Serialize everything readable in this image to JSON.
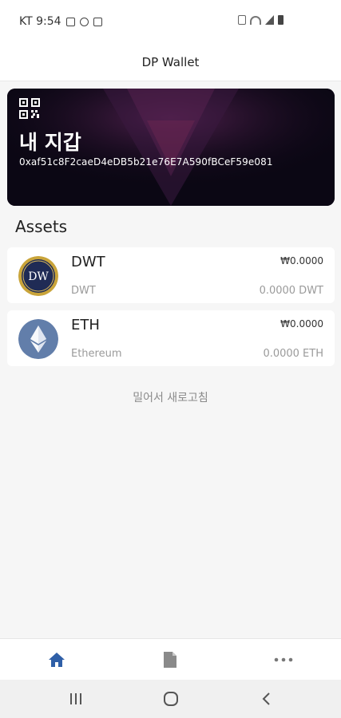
{
  "status_bar": {
    "carrier_time": "KT 9:54",
    "left_icons": [
      "image-icon",
      "phone-icon",
      "app-icon"
    ],
    "right_icons": [
      "mute-icon",
      "wifi-icon",
      "signal-icon",
      "battery-icon"
    ]
  },
  "header": {
    "title": "DP Wallet"
  },
  "wallet": {
    "name": "내 지갑",
    "address": "0xaf51c8F2caeD4eDB5b21e76E7A590fBCeF59e081",
    "icon": "qr-code-icon"
  },
  "assets": {
    "title": "Assets",
    "items": [
      {
        "symbol": "DWT",
        "name": "DWT",
        "fiat_value": "₩0.0000",
        "amount": "0.0000 DWT",
        "logo_text": "DW",
        "icon": "dwt-logo-icon"
      },
      {
        "symbol": "ETH",
        "name": "Ethereum",
        "fiat_value": "₩0.0000",
        "amount": "0.0000 ETH",
        "icon": "ethereum-logo-icon"
      }
    ]
  },
  "pull_refresh_text": "밀어서 새로고침",
  "bottom_nav": {
    "items": [
      {
        "icon": "home-icon",
        "active": true
      },
      {
        "icon": "document-icon",
        "active": false
      },
      {
        "icon": "more-icon",
        "active": false
      }
    ]
  },
  "system_nav": {
    "icons": [
      "recent-apps-icon",
      "home-button-icon",
      "back-icon"
    ]
  },
  "colors": {
    "accent": "#2f5fa7",
    "card_bg": "#0b0714",
    "card_highlight": "#4b2350",
    "eth_logo_bg": "#627eaa",
    "dwt_gold": "#c9a43a"
  }
}
